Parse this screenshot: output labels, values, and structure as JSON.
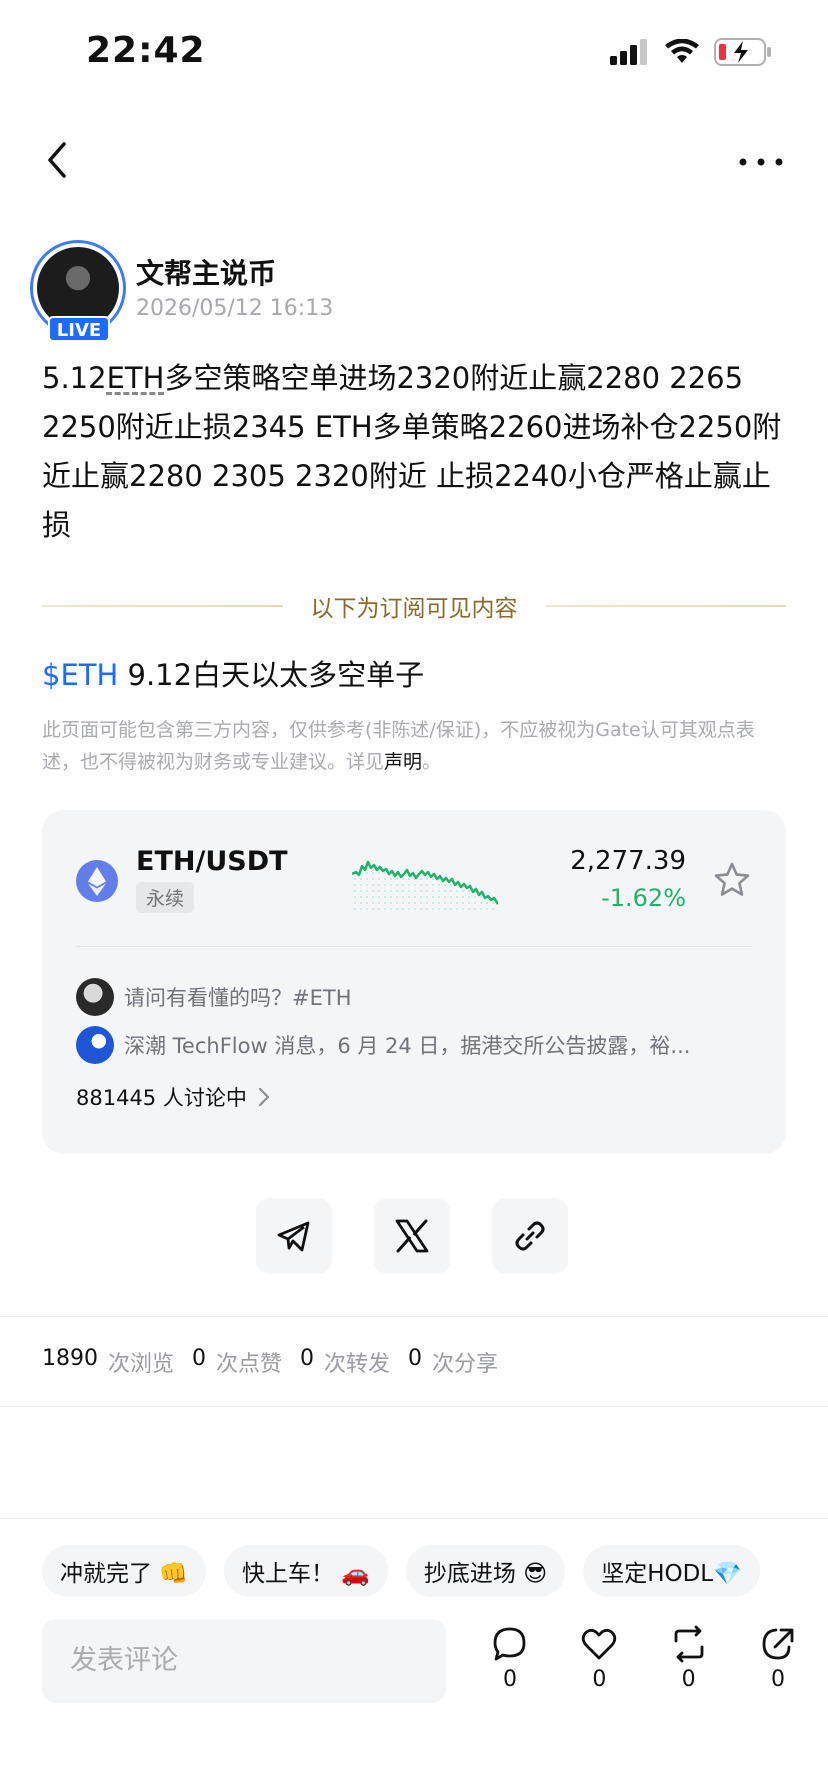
{
  "status_bar": {
    "time": "22:42"
  },
  "author": {
    "name": "文帮主说币",
    "date": "2026/05/12 16:13",
    "live_label": "LIVE"
  },
  "post": {
    "prefix": "5.12",
    "eth_word": "ETH",
    "body": "多空策略空单进场2320附近止赢2280 2265 2250附近止损2345 ETH多单策略2260进场补仓2250附近止赢2280 2305 2320附近 止损2240小仓严格止赢止损"
  },
  "subscription_divider": "以下为订阅可见内容",
  "sub_title": {
    "tag": "$ETH",
    "text": " 9.12白天以太多空单子"
  },
  "disclaimer": {
    "text": "此页面可能包含第三方内容，仅供参考(非陈述/保证)，不应被视为Gate认可其观点表述，也不得被视为财务或专业建议。详见",
    "link": "声明",
    "end": "。"
  },
  "ticker": {
    "pair": "ETH/USDT",
    "type": "永续",
    "price": "2,277.39",
    "change": "-1.62%",
    "colors": {
      "positive": "#1fb36b"
    },
    "feed": [
      {
        "text": "请问有看懂的吗？#ETH"
      },
      {
        "text": "深潮 TechFlow 消息，6 月 24 日，据港交所公告披露，裕..."
      }
    ],
    "discussion": "881445 人讨论中"
  },
  "stats": [
    {
      "num": "1890",
      "label": "次浏览"
    },
    {
      "num": "0",
      "label": "次点赞"
    },
    {
      "num": "0",
      "label": "次转发"
    },
    {
      "num": "0",
      "label": "次分享"
    }
  ],
  "chips": [
    "冲就完了 👊",
    "快上车！ 🚗",
    "抄底进场 😎",
    "坚定HODL💎"
  ],
  "comment": {
    "placeholder": "发表评论"
  },
  "actions": [
    {
      "icon": "comment-icon",
      "count": "0"
    },
    {
      "icon": "heart-icon",
      "count": "0"
    },
    {
      "icon": "repost-icon",
      "count": "0"
    },
    {
      "icon": "share-icon",
      "count": "0"
    }
  ]
}
